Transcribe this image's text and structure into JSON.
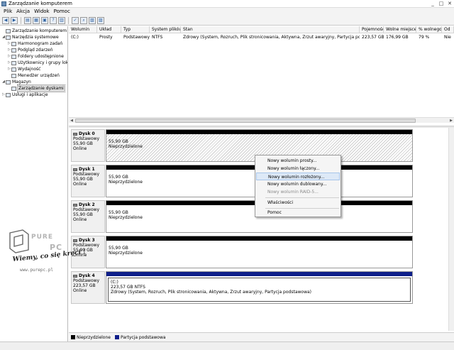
{
  "window": {
    "title": "Zarządzanie komputerem",
    "controls": [
      "_",
      "□",
      "✕"
    ]
  },
  "menu": [
    "Plik",
    "Akcja",
    "Widok",
    "Pomoc"
  ],
  "toolbar": {
    "icons": [
      "back-arrow-icon",
      "forward-arrow-icon",
      "up-folder-icon",
      "show-hide-tree-icon",
      "properties-icon",
      "help-icon",
      "console-icon",
      "check-icon",
      "search-icon",
      "open-icon",
      "view-icon"
    ]
  },
  "tree": [
    {
      "label": "Zarządzanie komputerem (lokal",
      "level": 0,
      "expander": ""
    },
    {
      "label": "Narzędzia systemowe",
      "level": 1,
      "expander": "◢"
    },
    {
      "label": "Harmonogram zadań",
      "level": 2,
      "expander": "▷"
    },
    {
      "label": "Podgląd zdarzeń",
      "level": 2,
      "expander": "▷"
    },
    {
      "label": "Foldery udostępnione",
      "level": 2,
      "expander": "▷"
    },
    {
      "label": "Użytkownicy i grupy lok",
      "level": 2,
      "expander": "▷"
    },
    {
      "label": "Wydajność",
      "level": 2,
      "expander": "▷"
    },
    {
      "label": "Menedżer urządzeń",
      "level": 2,
      "expander": ""
    },
    {
      "label": "Magazyn",
      "level": 1,
      "expander": "◢"
    },
    {
      "label": "Zarządzanie dyskami",
      "level": 2,
      "expander": "",
      "selected": true
    },
    {
      "label": "Usługi i aplikacje",
      "level": 1,
      "expander": "▷"
    }
  ],
  "volumes": {
    "columns": [
      "Wolumin",
      "Układ",
      "Typ",
      "System plików",
      "Stan",
      "Pojemność",
      "Wolne miejsce",
      "% wolnego",
      "Od"
    ],
    "rows": [
      [
        "(C:)",
        "Prosty",
        "Podstawowy",
        "NTFS",
        "Zdrowy (System, Rozruch, Plik stronicowania, Aktywna, Zrzut awaryjny, Partycja podstawowa)",
        "223,57 GB",
        "176,99 GB",
        "79 %",
        "Nie"
      ]
    ]
  },
  "disks": [
    {
      "name": "Dysk 0",
      "type": "Podstawowy",
      "size": "55,90 GB",
      "status": "Online",
      "part_size": "55,90 GB",
      "part_status": "Nieprzydzielone",
      "style": "hatched"
    },
    {
      "name": "Dysk 1",
      "type": "Podstawowy",
      "size": "55,90 GB",
      "status": "Online",
      "part_size": "55,90 GB",
      "part_status": "Nieprzydzielone",
      "style": "plain"
    },
    {
      "name": "Dysk 2",
      "type": "Podstawowy",
      "size": "55,90 GB",
      "status": "Online",
      "part_size": "55,90 GB",
      "part_status": "Nieprzydzielone",
      "style": "plain"
    },
    {
      "name": "Dysk 3",
      "type": "Podstawowy",
      "size": "55,90 GB",
      "status": "Online",
      "part_size": "55,90 GB",
      "part_status": "Nieprzydzielone",
      "style": "plain"
    },
    {
      "name": "Dysk 4",
      "type": "Podstawowy",
      "size": "223,57 GB",
      "status": "Online",
      "part_name": "(C:)",
      "part_size": "223,57 GB NTFS",
      "part_status": "Zdrowy (System, Rozruch, Plik stronicowania, Aktywna, Zrzut awaryjny, Partycja podstawowa)",
      "style": "primary"
    }
  ],
  "legend": [
    {
      "label": "Nieprzydzielone",
      "color": "#000000"
    },
    {
      "label": "Partycja podstawowa",
      "color": "#0e1f8a"
    }
  ],
  "context_menu": {
    "items": [
      {
        "label": "Nowy wolumin prosty...",
        "enabled": true
      },
      {
        "label": "Nowy wolumin łączony...",
        "enabled": true
      },
      {
        "label": "Nowy wolumin rozłożony...",
        "enabled": true,
        "hover": true
      },
      {
        "label": "Nowy wolumin dublowany...",
        "enabled": true
      },
      {
        "label": "Nowy wolumin RAID-5...",
        "enabled": false
      },
      {
        "label": "Właściwości",
        "enabled": true
      },
      {
        "label": "Pomoc",
        "enabled": true
      }
    ]
  },
  "watermark": {
    "brand": "PURE PC",
    "slogan": "Wiemy, co się kręci !",
    "url": "www.purepc.pl"
  }
}
